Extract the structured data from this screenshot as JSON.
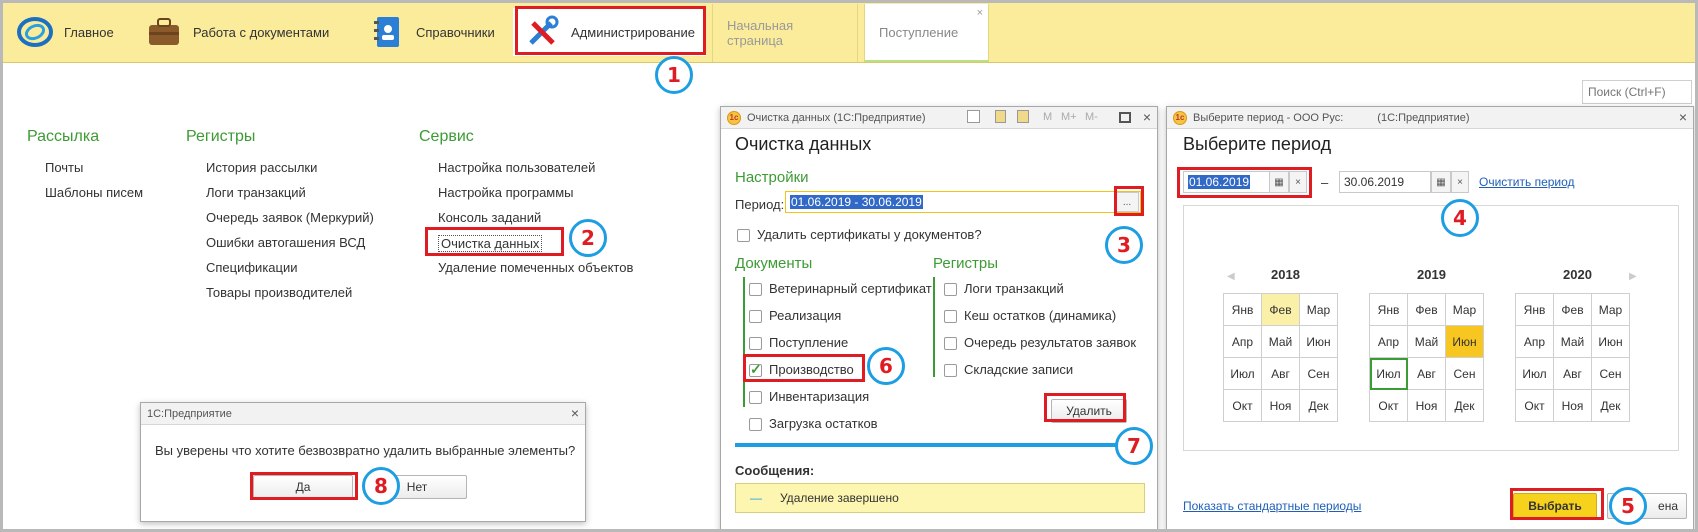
{
  "nav": {
    "items": [
      {
        "label": "Главное",
        "icon": "app-logo-icon"
      },
      {
        "label": "Работа с документами",
        "icon": "briefcase-icon"
      },
      {
        "label": "Справочники",
        "icon": "directory-book-icon"
      },
      {
        "label": "Администрирование",
        "icon": "tools-icon"
      }
    ],
    "tabs": [
      {
        "label": "Начальная страница"
      },
      {
        "label": "Поступление",
        "close": "×"
      }
    ]
  },
  "search": {
    "placeholder": "Поиск (Ctrl+F)"
  },
  "menu": {
    "col1": {
      "title": "Рассылка",
      "items": [
        "Почты",
        "Шаблоны писем"
      ]
    },
    "col2": {
      "title": "Регистры",
      "items": [
        "История рассылки",
        "Логи транзакций",
        "Очередь заявок (Меркурий)",
        "Ошибки автогашения ВСД",
        "Спецификации",
        "Товары производителей"
      ]
    },
    "col3": {
      "title": "Сервис",
      "items": [
        "Настройка пользователей",
        "Настройка программы",
        "Консоль заданий",
        "Очистка данных",
        "Удаление помеченных объектов"
      ]
    }
  },
  "confirm": {
    "title": "1С:Предприятие",
    "close": "×",
    "message": "Вы уверены что хотите безвозвратно удалить выбранные элементы?",
    "yes": "Да",
    "no": "Нет"
  },
  "cleanup": {
    "title": "Очистка данных  (1С:Предприятие)",
    "logo": "1с",
    "toolbar": [
      "M",
      "M+",
      "M-"
    ],
    "heading": "Очистка данных",
    "settings_label": "Настройки",
    "period_label": "Период:",
    "period_value": "01.06.2019 - 30.06.2019",
    "period_btn": "...",
    "delete_certs": "Удалить сертификаты у документов?",
    "docs_label": "Документы",
    "docs": [
      {
        "label": "Ветеринарный сертификат",
        "checked": false
      },
      {
        "label": "Реализация",
        "checked": false
      },
      {
        "label": "Поступление",
        "checked": false
      },
      {
        "label": "Производство",
        "checked": true
      },
      {
        "label": "Инвентаризация",
        "checked": false
      },
      {
        "label": "Загрузка остатков",
        "checked": false
      }
    ],
    "regs_label": "Регистры",
    "regs": [
      {
        "label": "Логи транзакций",
        "checked": false
      },
      {
        "label": "Кеш остатков (динамика)",
        "checked": false
      },
      {
        "label": "Очередь результатов заявок",
        "checked": false
      },
      {
        "label": "Складские записи",
        "checked": false
      }
    ],
    "delete_btn": "Удалить",
    "progress": 1.0,
    "messages_label": "Сообщения:",
    "message": "Удаление завершено",
    "message_dash": "—"
  },
  "period": {
    "title": "Выберите период - ООО Рус:",
    "title_app": "(1С:Предприятие)",
    "logo": "1с",
    "heading": "Выберите период",
    "from": "01.06.2019",
    "to": "30.06.2019",
    "dash": "–",
    "clear_x": "×",
    "clear_link": "Очистить период",
    "years": [
      "2018",
      "2019",
      "2020"
    ],
    "months": [
      "Янв",
      "Фев",
      "Мар",
      "Апр",
      "Май",
      "Июн",
      "Июл",
      "Авг",
      "Сен",
      "Окт",
      "Ноя",
      "Дек"
    ],
    "show_std": "Показать стандартные периоды",
    "select_btn": "Выбрать",
    "cancel_btn": "ена",
    "arrows": {
      "prev": "◀",
      "next": "▶"
    }
  },
  "steps": [
    "1",
    "2",
    "3",
    "4",
    "5",
    "6",
    "7",
    "8"
  ],
  "colors": {
    "accent_red": "#e01c23",
    "step_blue": "#1d9ee2",
    "green": "#3d9b35",
    "topbar": "#fbec9b"
  }
}
